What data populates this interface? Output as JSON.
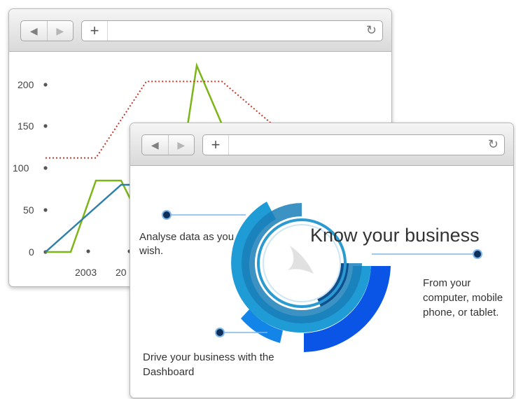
{
  "back_window": {
    "toolbar": {
      "back_icon": "◀",
      "forward_icon": "▶",
      "new_tab_icon": "+",
      "reload_icon": "↻",
      "url": ""
    },
    "chart_data": {
      "type": "line",
      "y_ticks": [
        "200",
        "150",
        "100",
        "50",
        "0"
      ],
      "x_ticks": [
        "2003",
        "20"
      ],
      "ylim": [
        0,
        230
      ],
      "grid": false,
      "series": [
        {
          "color": "#7cb518",
          "points": [
            [
              0,
              0
            ],
            [
              1,
              0
            ],
            [
              2,
              85
            ],
            [
              3,
              85
            ],
            [
              4,
              25
            ],
            [
              5,
              25
            ],
            [
              6,
              222
            ],
            [
              7,
              152
            ],
            [
              8,
              152
            ]
          ]
        },
        {
          "color": "#2f7fa8",
          "points": [
            [
              0,
              0
            ],
            [
              3,
              80
            ],
            [
              5,
              80
            ]
          ]
        },
        {
          "color": "#c0392b",
          "style": "dotted",
          "points": [
            [
              0,
              112
            ],
            [
              2,
              112
            ],
            [
              4,
              203
            ],
            [
              7,
              203
            ],
            [
              9,
              152
            ],
            [
              10,
              152
            ]
          ]
        }
      ]
    }
  },
  "front_window": {
    "toolbar": {
      "back_icon": "◀",
      "forward_icon": "▶",
      "new_tab_icon": "+",
      "reload_icon": "↻",
      "url": ""
    },
    "headline": "Know your business",
    "callouts": {
      "analyse": "Analyse data as you wish.",
      "devices": "From your computer, mobile phone, or tablet.",
      "dashboard": "Drive your business with the Dashboard"
    },
    "colors": {
      "accent_dark": "#0d2f5c",
      "accent": "#1e88c7",
      "accent_bright": "#0a7cf0",
      "line": "#7fb6e6"
    }
  }
}
